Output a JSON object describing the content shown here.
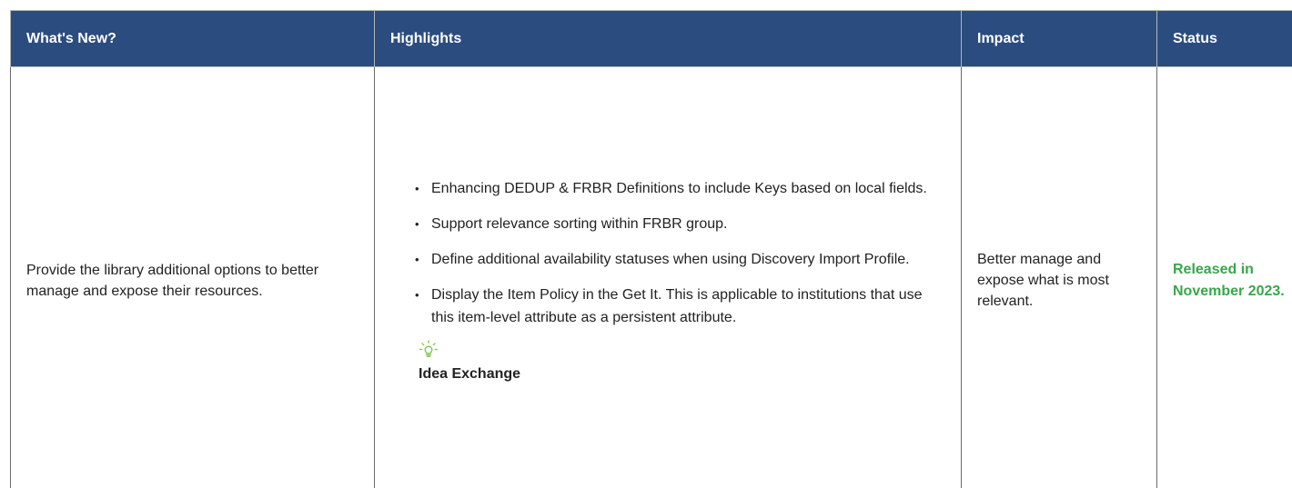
{
  "table": {
    "headers": [
      "What's New?",
      "Highlights",
      "Impact",
      "Status"
    ],
    "row": {
      "whats_new": "Provide the library additional options to better manage and expose their resources.",
      "highlights": [
        "Enhancing DEDUP & FRBR Definitions to include Keys based on local fields.",
        "Support relevance sorting within FRBR group.",
        "Define additional availability statuses when using Discovery Import Profile.",
        "Display the Item Policy in the Get It. This is applicable to institutions that use this item-level attribute as a persistent attribute."
      ],
      "idea_exchange_label": "Idea Exchange",
      "idea_icon": "lightbulb-icon",
      "impact": "Better manage and expose what is most relevant.",
      "status": "Released in November 2023."
    }
  },
  "colors": {
    "header_bg": "#2b4c7f",
    "header_text": "#ffffff",
    "status_green": "#3aa64b",
    "idea_icon_green": "#7cc243"
  }
}
